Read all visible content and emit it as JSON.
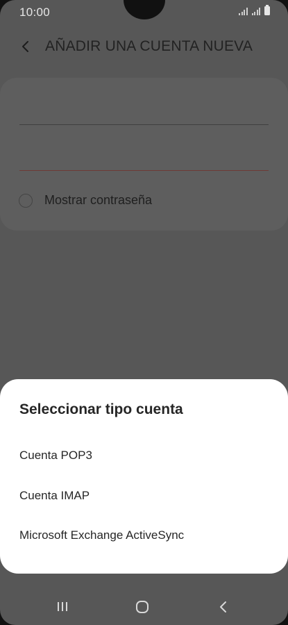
{
  "status_bar": {
    "time": "10:00"
  },
  "header": {
    "back_icon": "back-arrow-icon",
    "title": "AÑADIR UNA CUENTA NUEVA"
  },
  "form": {
    "show_password_label": "Mostrar contraseña",
    "show_password_checked": false
  },
  "sheet": {
    "title": "Seleccionar tipo cuenta",
    "options": [
      "Cuenta POP3",
      "Cuenta IMAP",
      "Microsoft Exchange ActiveSync"
    ]
  },
  "navigation": {
    "recent_icon": "recent-apps-icon",
    "home_icon": "home-icon",
    "back_icon": "back-icon"
  },
  "colors": {
    "scrim": "#575757",
    "sheet_bg": "#ffffff",
    "field_error_line": "#6e3a36"
  }
}
